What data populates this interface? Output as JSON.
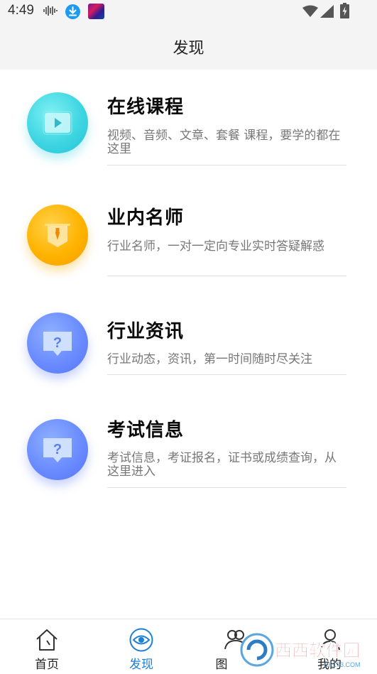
{
  "status_bar": {
    "time": "4:49",
    "icons": [
      "audio-wave-icon",
      "download-icon",
      "app-thumbnail",
      "wifi-icon",
      "signal-icon",
      "battery-icon"
    ]
  },
  "header": {
    "title": "发现"
  },
  "features": [
    {
      "title": "在线课程",
      "desc": "视频、音频、文章、套餐 课程，要学的都在这里",
      "icon": "video-play-icon",
      "color": "#3fd6e2"
    },
    {
      "title": "业内名师",
      "desc": "行业名师，一对一定向专业实时答疑解惑",
      "icon": "teacher-banner-icon",
      "color": "#ffb300"
    },
    {
      "title": "行业资讯",
      "desc": "行业动态，资讯，第一时间随时尽关注",
      "icon": "question-bubble-icon",
      "color": "#6a8cff"
    },
    {
      "title": "考试信息",
      "desc": "考试信息，考证报名，证书或成绩查询，从这里进入",
      "icon": "question-bubble-icon",
      "color": "#6a8cff"
    }
  ],
  "bottom_nav": {
    "items": [
      {
        "label": "首页",
        "icon": "home-icon",
        "active": false
      },
      {
        "label": "发现",
        "icon": "eye-icon",
        "active": true
      },
      {
        "label": "图",
        "icon": "users-icon",
        "active": false
      },
      {
        "label": "我的",
        "icon": "user-icon",
        "active": false
      }
    ]
  },
  "watermark": {
    "text": "西西软件园",
    "subtext": "CR173.COM"
  },
  "colors": {
    "accent": "#1e7fd8",
    "cyan": "#3fd6e2",
    "orange": "#ffb300",
    "blue": "#6a8cff"
  }
}
